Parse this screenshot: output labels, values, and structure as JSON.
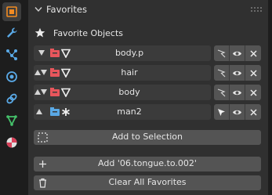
{
  "panel": {
    "title": "Favorites",
    "subheader": "Favorite Objects"
  },
  "rows": [
    {
      "name": "body.p",
      "type": "mesh",
      "selected": false
    },
    {
      "name": "hair",
      "type": "mesh",
      "selected": false
    },
    {
      "name": "body",
      "type": "mesh",
      "selected": false
    },
    {
      "name": "man2",
      "type": "armature",
      "selected": true
    }
  ],
  "buttons": {
    "add_selection": "Add to Selection",
    "add_object": "Add '06.tongue.to.002'",
    "clear_all": "Clear All Favorites"
  },
  "colors": {
    "accent_orange": "#f28b22",
    "mesh_red": "#e8565c",
    "armature_blue": "#5aa9e6",
    "green": "#45c26b"
  },
  "icons": {
    "tabs": [
      "tool-icon",
      "wrench-icon",
      "particles-icon",
      "physics-icon",
      "constraint-icon",
      "data-icon",
      "material-icon"
    ]
  }
}
